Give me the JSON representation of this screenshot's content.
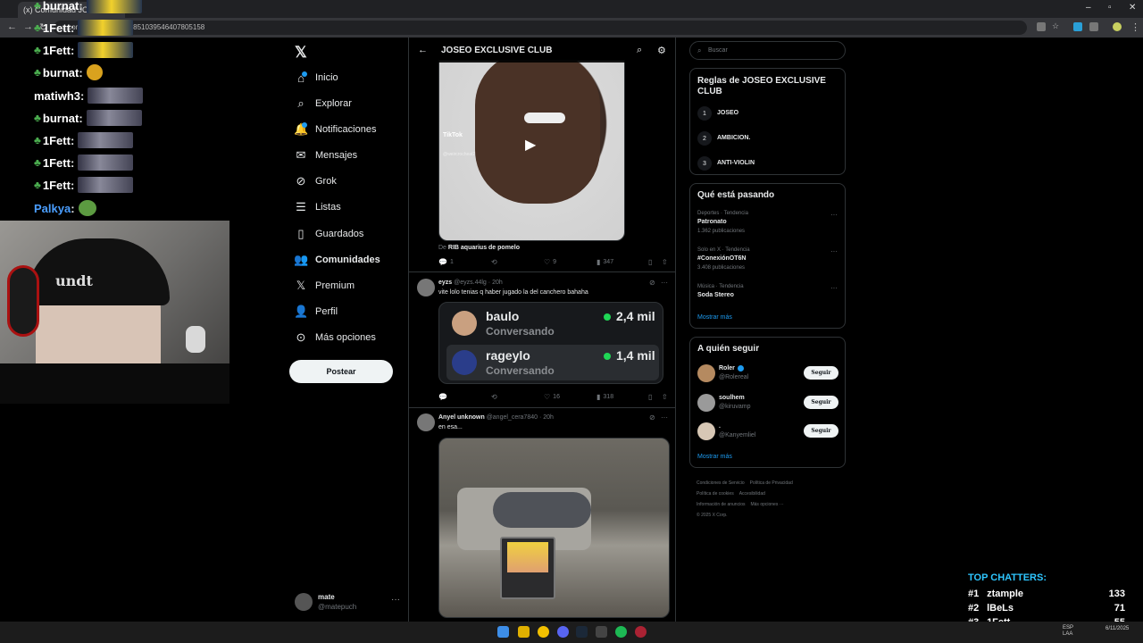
{
  "browser": {
    "tab_title": "(x) Comunidad JOSEO E...",
    "url": "x.com/i/communities/1851039546407805158"
  },
  "chat": [
    {
      "name": "burnat",
      "color": "white",
      "emote": "yellow"
    },
    {
      "name": "1Fett",
      "color": "white",
      "emote": "yellow"
    },
    {
      "name": "1Fett",
      "color": "white",
      "emote": "yellow"
    },
    {
      "name": "burnat",
      "color": "white",
      "emote": "small"
    },
    {
      "name": "matiwh3",
      "color": "white",
      "emote": "grey",
      "no_badge": true
    },
    {
      "name": "burnat",
      "color": "white",
      "emote": "grey"
    },
    {
      "name": "1Fett",
      "color": "white",
      "emote": "grey"
    },
    {
      "name": "1Fett",
      "color": "white",
      "emote": "grey"
    },
    {
      "name": "1Fett",
      "color": "white",
      "emote": "grey"
    },
    {
      "name": "Palkya",
      "color": "blue",
      "emote": "pepe",
      "no_badge": true
    }
  ],
  "webcam": {
    "beanie_text": "undt"
  },
  "sidebar": {
    "items": [
      {
        "label": "Inicio",
        "icon": "home-icon"
      },
      {
        "label": "Explorar",
        "icon": "search-icon"
      },
      {
        "label": "Notificaciones",
        "icon": "bell-icon"
      },
      {
        "label": "Mensajes",
        "icon": "mail-icon"
      },
      {
        "label": "Grok",
        "icon": "grok-icon"
      },
      {
        "label": "Listas",
        "icon": "list-icon"
      },
      {
        "label": "Guardados",
        "icon": "bookmark-icon"
      },
      {
        "label": "Comunidades",
        "icon": "communities-icon"
      },
      {
        "label": "Premium",
        "icon": "x-premium-icon"
      },
      {
        "label": "Perfil",
        "icon": "profile-icon"
      },
      {
        "label": "Más opciones",
        "icon": "more-icon"
      }
    ],
    "post_label": "Postear",
    "user": {
      "name": "mate",
      "handle": "@matepuch"
    }
  },
  "main": {
    "title": "JOSEO EXCLUSIVE CLUB",
    "video_post": {
      "tiktok_label": "TikTok",
      "tiktok_handle": "@weircrocheat2",
      "caption_prefix": "De",
      "caption_source": "RIB aquarius de pomelo",
      "replies": "1",
      "likes": "9",
      "views": "347"
    },
    "tweet1": {
      "name": "eyzs",
      "handle": "@eyzs.44lg",
      "time": "20h",
      "text": "vite lolo tenias q haber jugado la del canchero bahaha",
      "likes": "16",
      "views": "318",
      "streamers": [
        {
          "name": "baulo",
          "status": "Conversando",
          "count": "2,4 mil"
        },
        {
          "name": "rageylo",
          "status": "Conversando",
          "count": "1,4 mil"
        }
      ]
    },
    "tweet2": {
      "name": "Anyel unknown",
      "handle": "@angel_cera7840",
      "time": "20h",
      "text": "en esa..."
    }
  },
  "right": {
    "search_placeholder": "Buscar",
    "rules_title": "Reglas de JOSEO EXCLUSIVE CLUB",
    "rules": [
      {
        "num": "1",
        "text": "JOSEO"
      },
      {
        "num": "2",
        "text": "AMBICION."
      },
      {
        "num": "3",
        "text": "ANTI-VIOLIN"
      }
    ],
    "trends_title": "Qué está pasando",
    "trends": [
      {
        "meta": "Deportes · Tendencia",
        "name": "Patronato",
        "count": "1.362 publicaciones"
      },
      {
        "meta": "Solo en X · Tendencia",
        "name": "#ConexiónOT6N",
        "count": "3.408 publicaciones"
      },
      {
        "meta": "Música · Tendencia",
        "name": "Soda Stereo",
        "count": ""
      }
    ],
    "show_more": "Mostrar más",
    "follow_title": "A quién seguir",
    "follow": [
      {
        "name": "Roler",
        "handle": "@Rolereal",
        "verified": true
      },
      {
        "name": "soulhem",
        "handle": "@kiruvamp",
        "verified": false
      },
      {
        "name": ".",
        "handle": "@Kanyemliel",
        "verified": false
      }
    ],
    "follow_label": "Seguir",
    "footer": [
      "Condiciones de Servicio",
      "Política de Privacidad",
      "Política de cookies",
      "Accesibilidad",
      "Información de anuncios",
      "Más opciones ···",
      "© 2025 X Corp."
    ]
  },
  "top_chatters": {
    "title": "TOP CHATTERS:",
    "rows": [
      {
        "rank": "#1",
        "name": "ztample",
        "count": "133"
      },
      {
        "rank": "#2",
        "name": "lBeLs",
        "count": "71"
      },
      {
        "rank": "#3",
        "name": "1Fett",
        "count": "55"
      }
    ]
  },
  "taskbar": {
    "lang": "ESP",
    "lang2": "LAA",
    "date": "6/11/2025"
  }
}
